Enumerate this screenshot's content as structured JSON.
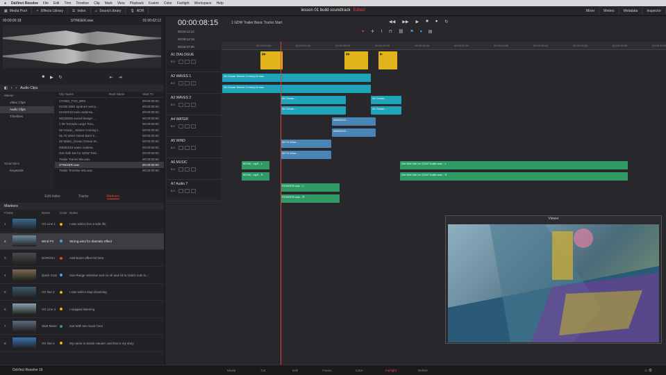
{
  "menubar": {
    "apple": "●",
    "app": "DaVinci Resolve",
    "items": [
      "File",
      "Edit",
      "Trim",
      "Timeline",
      "Clip",
      "Mark",
      "View",
      "Playback",
      "Fusion",
      "Color",
      "Fairlight",
      "Workspace",
      "Help"
    ]
  },
  "toolbar": {
    "left": [
      "Media Pool",
      "Effects Library",
      "Index",
      "Sound Library",
      "ADR"
    ],
    "right": [
      "Mixer",
      "Meters",
      "Metadata",
      "Inspector"
    ]
  },
  "project": {
    "title": "lesson 01 build soundtrack",
    "status": "Edited"
  },
  "source": {
    "name": "STINGER.wav",
    "tc_in": "00:00:00:18",
    "tc_out": "01:00:02:12"
  },
  "transport_icons": [
    "■",
    "▶",
    "↻",
    "⇤",
    "⇥"
  ],
  "clip_panel": {
    "title": "Audio Clips"
  },
  "bins": [
    {
      "label": "Master",
      "group": true
    },
    {
      "label": "Video Clips"
    },
    {
      "label": "Audio Clips",
      "selected": true
    },
    {
      "label": "Timelines"
    }
  ],
  "smartbins": {
    "label": "Smart Bins",
    "item": "Keywords"
  },
  "clip_columns": [
    "Clip Name",
    "Reel Name",
    "Start TC"
  ],
  "clips": [
    {
      "name": "170302_TVO_BRK",
      "tc": "00:00:00:00"
    },
    {
      "name": "02190 DBG spotrum wet p...",
      "tc": "00:00:00:00"
    },
    {
      "name": "02192915 train undersw...",
      "tc": "00:00:00:00"
    },
    {
      "name": "06226026 sound design ...",
      "tc": "00:00:00:00"
    },
    {
      "name": "1 MI Tornado Large Toru...",
      "tc": "00:00:00:00"
    },
    {
      "name": "06 Ocean_ Waves Coming I...",
      "tc": "00:00:00:00"
    },
    {
      "name": "05.70 Wind Volent Burn h...",
      "tc": "00:00:00:00"
    },
    {
      "name": "25 Water_Ocean Ocean W...",
      "tc": "00:00:00:00"
    },
    {
      "name": "00692233 water underw...",
      "tc": "00:00:00:00"
    },
    {
      "name": "Get With Me for GDW Trail...",
      "tc": "00:00:00:00"
    },
    {
      "name": "Trailer Tracks Mix.wav",
      "tc": "00:00:00:00"
    },
    {
      "name": "STINGER.wav",
      "tc": "00:00:00:00",
      "selected": true
    },
    {
      "name": "Trailer Timeline Mix.wav",
      "tc": "00:00:00:00"
    }
  ],
  "clip_tabs": [
    "Edit Index",
    "Tracks",
    "Markers"
  ],
  "markers": {
    "title": "Markers",
    "columns": [
      "Frame",
      "Name",
      "Color",
      "Notes"
    ],
    "rows": [
      {
        "n": "1",
        "name": "VO Line 1",
        "color": "#e0b41a",
        "note": "I was told to live a safe life",
        "thumb": "#3a6a90"
      },
      {
        "n": "2",
        "name": "Wind FX",
        "color": "#4aa8d8",
        "note": "Strong wind for dramatic effect",
        "thumb": "#6a8aa0",
        "selected": true
      },
      {
        "n": "3",
        "name": "DCROSA",
        "color": "#e0433a",
        "note": "Add Boom effect hit here",
        "thumb": "#4a4a4e"
      },
      {
        "n": "4",
        "name": "Quick Cuts",
        "color": "#4aa8d8",
        "note": "Use Range selection tool on All and Alt to match cuts to...",
        "thumb": "#7a6a50"
      },
      {
        "n": "5",
        "name": "VO line 2",
        "color": "#e0b41a",
        "note": "I was told to stop dreaming",
        "thumb": "#3a5a70"
      },
      {
        "n": "6",
        "name": "VO Line 3",
        "color": "#e0b41a",
        "note": "I stopped listening",
        "thumb": "#8aa0b0"
      },
      {
        "n": "7",
        "name": "Start Music",
        "color": "#2f9a63",
        "note": "Get With Me music here",
        "thumb": "#5a6a80"
      },
      {
        "n": "8",
        "name": "VO line 4",
        "color": "#e0b41a",
        "note": "My name is Sarah Hauser, and this is my story",
        "thumb": "#3a70b0"
      }
    ]
  },
  "timeline": {
    "timecode": "00:00:08:15",
    "name": "1 GDW Trailer Basic Tracks Start",
    "info": [
      "00:00:12:12",
      "00:00:13:18",
      "00:00:07:06"
    ],
    "ruler": [
      "00:00:00:00",
      "00:00:04:00",
      "00:00:08:00",
      "00:00:12:00",
      "00:00:16:00",
      "00:00:20:00",
      "00:00:24:00",
      "00:00:28:00",
      "00:00:32:00",
      "00:00:36:00",
      "00:00:40:00"
    ],
    "tracks": [
      {
        "id": "A1",
        "name": "DIALOGUE",
        "vol": "0.0"
      },
      {
        "id": "A2",
        "name": "WAVES 1",
        "vol": "0.0"
      },
      {
        "id": "A3",
        "name": "WAVES 2",
        "vol": "0.0"
      },
      {
        "id": "A4",
        "name": "WATER",
        "vol": "0.0"
      },
      {
        "id": "A5",
        "name": "WIND",
        "vol": "0.0"
      },
      {
        "id": "A6",
        "name": "MUSIC",
        "vol": "0.0"
      },
      {
        "id": "A7",
        "name": "Audio 7",
        "vol": "0.0"
      }
    ]
  },
  "clips_tl": {
    "wave_a": "06 Ocean Waves Coming In.wav",
    "wave_b": "06 Ocean...",
    "water": "00692233...",
    "wind": "05.70 Wind...",
    "music_a": "90766...mp3 - L",
    "music_b": "90766...mp3 - R",
    "music_long_a": "Get With Me for GDW Trailer.wav - L",
    "music_long_b": "Get With Me for GDW Trailer.wav - R",
    "stinger_a": "STINGER.wav - L",
    "stinger_b": "STINGER.wav - R"
  },
  "viewer": {
    "title": "Viewer"
  },
  "pages": [
    "Media",
    "Cut",
    "Edit",
    "Fusion",
    "Color",
    "Fairlight",
    "Deliver"
  ],
  "active_page": "Fairlight",
  "footer": {
    "app": "DaVinci Resolve 16"
  }
}
